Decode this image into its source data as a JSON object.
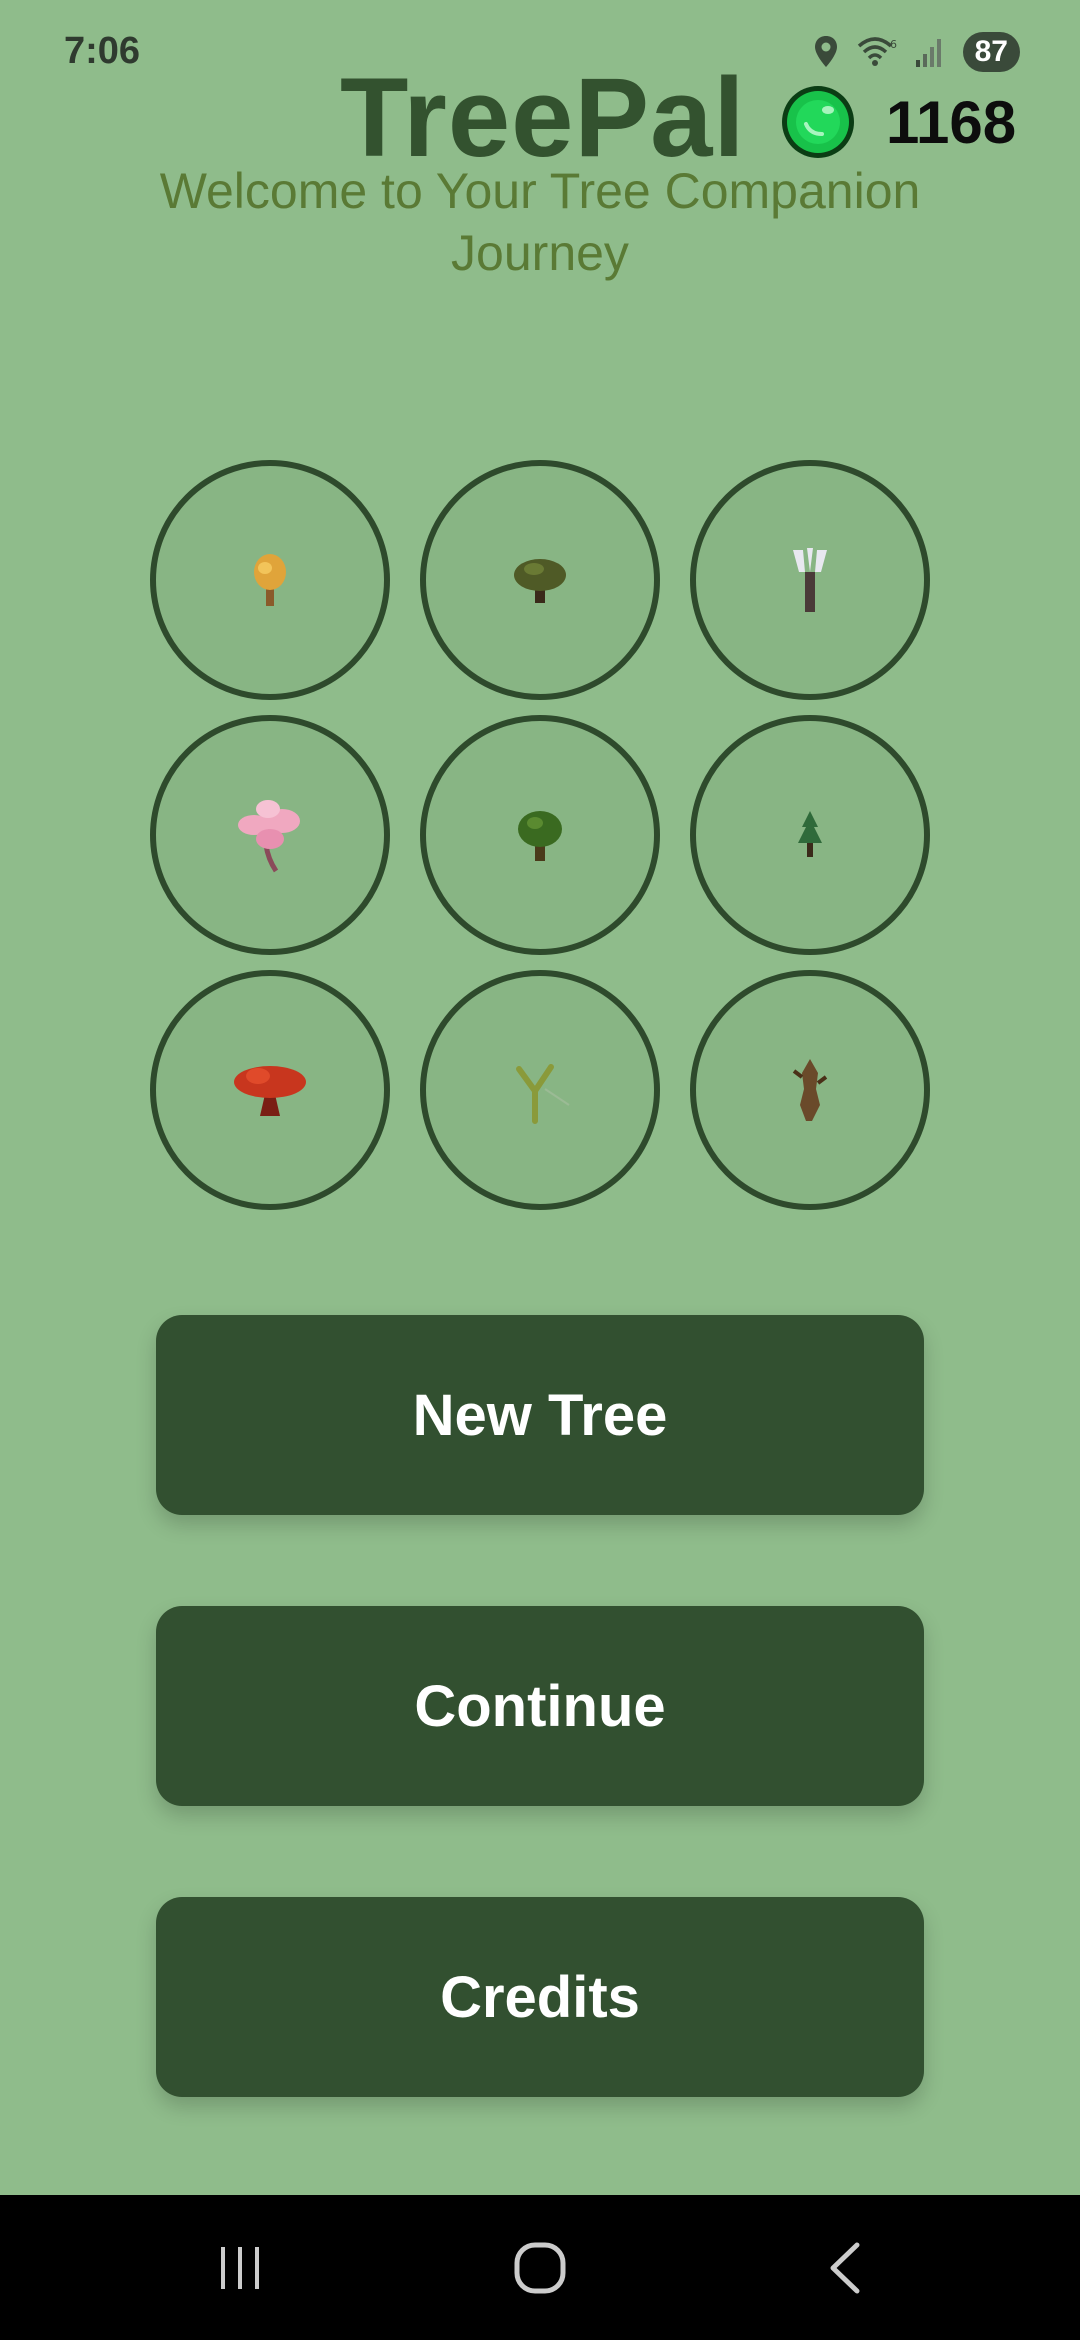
{
  "status_bar": {
    "time": "7:06",
    "icons": [
      "location-icon",
      "wifi-icon",
      "signal-icon"
    ],
    "battery": "87"
  },
  "header": {
    "title": "TreePal",
    "coin_icon": "green-gem-icon",
    "coin_count": "1168",
    "welcome_text": "Welcome to Your Tree Companion Journey"
  },
  "trees": [
    {
      "name": "golden-tree-icon",
      "color": "#e0a43a"
    },
    {
      "name": "oak-tree-icon",
      "color": "#4f5a26"
    },
    {
      "name": "frost-tree-icon",
      "color": "#e8e8f0"
    },
    {
      "name": "cherry-blossom-tree-icon",
      "color": "#f0a8c0"
    },
    {
      "name": "green-bush-tree-icon",
      "color": "#3a6a20"
    },
    {
      "name": "pine-sapling-icon",
      "color": "#2f6a3a"
    },
    {
      "name": "red-maple-tree-icon",
      "color": "#c8361e"
    },
    {
      "name": "forked-sapling-icon",
      "color": "#8a9a3a"
    },
    {
      "name": "withered-tree-icon",
      "color": "#6a4a2a"
    }
  ],
  "buttons": {
    "new_tree": "New Tree",
    "continue": "Continue",
    "credits": "Credits"
  },
  "colors": {
    "background": "#8fbc8b",
    "title": "#33522f",
    "button": "#325030",
    "welcome": "#5a7a35"
  },
  "nav": {
    "recents": "recents-icon",
    "home": "home-icon",
    "back": "back-icon"
  }
}
